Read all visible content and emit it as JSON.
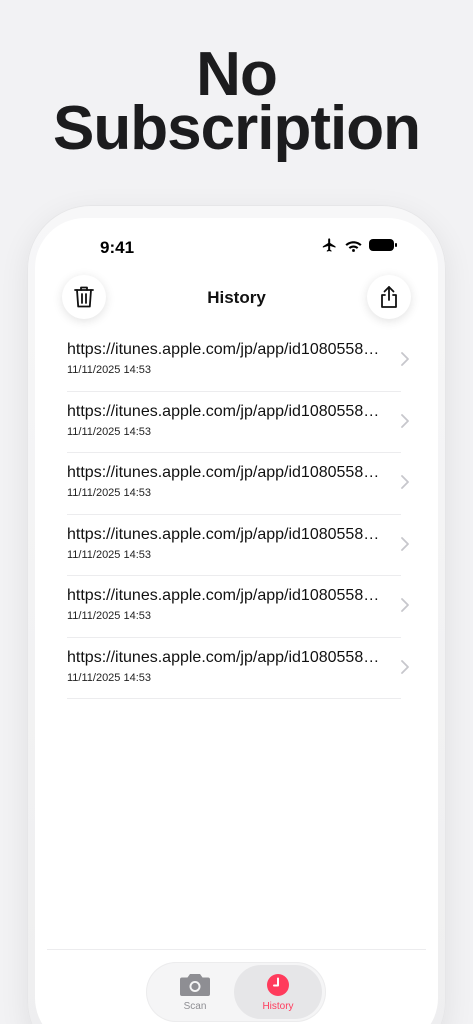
{
  "headline": {
    "line1": "No",
    "line2": "Subscription"
  },
  "status_bar": {
    "time": "9:41"
  },
  "nav": {
    "title": "History"
  },
  "history": {
    "items": [
      {
        "url": "https://itunes.apple.com/jp/app/id1080558…",
        "date": "11/11/2025 14:53"
      },
      {
        "url": "https://itunes.apple.com/jp/app/id1080558…",
        "date": "11/11/2025 14:53"
      },
      {
        "url": "https://itunes.apple.com/jp/app/id1080558…",
        "date": "11/11/2025 14:53"
      },
      {
        "url": "https://itunes.apple.com/jp/app/id1080558…",
        "date": "11/11/2025 14:53"
      },
      {
        "url": "https://itunes.apple.com/jp/app/id1080558…",
        "date": "11/11/2025 14:53"
      },
      {
        "url": "https://itunes.apple.com/jp/app/id1080558…",
        "date": "11/11/2025 14:53"
      }
    ]
  },
  "tabs": [
    {
      "label": "Scan",
      "icon": "camera-icon",
      "selected": false
    },
    {
      "label": "History",
      "icon": "clock-icon",
      "selected": true
    }
  ],
  "colors": {
    "accent": "#ff3b5c",
    "inactive": "#8e8e93"
  }
}
